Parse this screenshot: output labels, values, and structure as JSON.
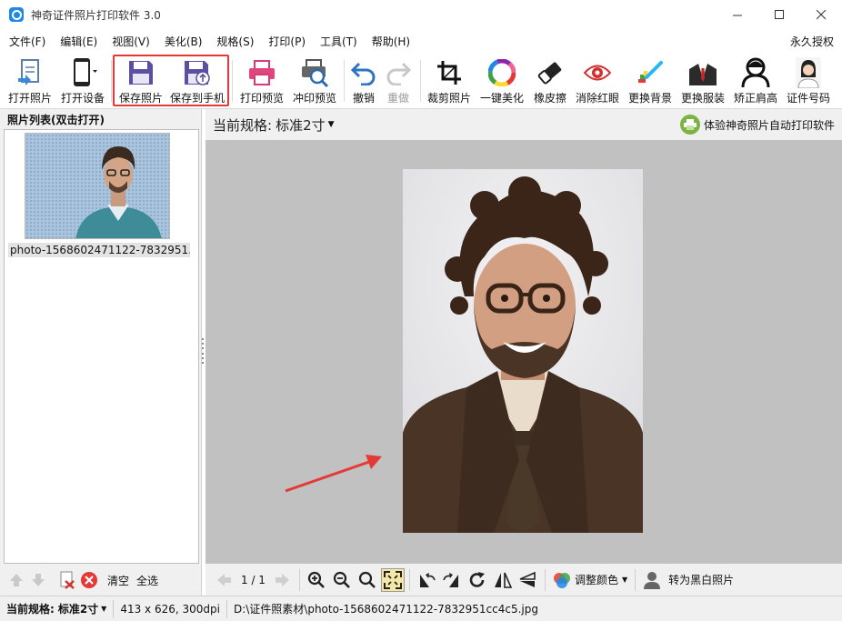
{
  "window": {
    "title": "神奇证件照片打印软件 3.0",
    "controls": [
      "minimize",
      "maximize",
      "close"
    ]
  },
  "menu": {
    "items": [
      "文件(F)",
      "编辑(E)",
      "视图(V)",
      "美化(B)",
      "规格(S)",
      "打印(P)",
      "工具(T)",
      "帮助(H)"
    ],
    "license": "永久授权"
  },
  "toolbar": {
    "items": [
      {
        "label": "打开照片",
        "icon": "open-photo-icon"
      },
      {
        "label": "打开设备",
        "icon": "phone-device-icon"
      },
      {
        "label": "保存照片",
        "icon": "save-icon"
      },
      {
        "label": "保存到手机",
        "icon": "save-to-phone-icon"
      },
      {
        "label": "打印预览",
        "icon": "printer-icon"
      },
      {
        "label": "冲印预览",
        "icon": "print-preview-icon"
      },
      {
        "label": "撤销",
        "icon": "undo-icon"
      },
      {
        "label": "重做",
        "icon": "redo-icon"
      },
      {
        "label": "裁剪照片",
        "icon": "crop-icon"
      },
      {
        "label": "一键美化",
        "icon": "color-wheel-icon"
      },
      {
        "label": "橡皮擦",
        "icon": "eraser-icon"
      },
      {
        "label": "消除红眼",
        "icon": "red-eye-icon"
      },
      {
        "label": "更换背景",
        "icon": "change-background-icon"
      },
      {
        "label": "更换服装",
        "icon": "suit-icon"
      },
      {
        "label": "矫正肩高",
        "icon": "shoulder-icon"
      },
      {
        "label": "证件号码",
        "icon": "id-photo-icon"
      }
    ]
  },
  "left_panel": {
    "title": "照片列表(双击打开)",
    "photo_name": "photo-1568602471122-7832951...",
    "clear_label": "清空",
    "select_all_label": "全选"
  },
  "main": {
    "spec_label": "当前规格:",
    "spec_value": "标准2寸",
    "promo": "体验神奇照片自动打印软件",
    "page_indicator": "1 / 1",
    "adjust_color_label": "调整颜色",
    "to_bw_label": "转为黑白照片"
  },
  "status": {
    "spec_label": "当前规格:",
    "spec_value": "标准2寸",
    "dimensions": "413 x 626, 300dpi",
    "file_path": "D:\\证件照素材\\photo-1568602471122-7832951cc4c5.jpg"
  },
  "colors": {
    "highlight_border": "#e53935",
    "arrow": "#e53935",
    "canvas_bg": "#c1c1c1",
    "accent_blue": "#1e88e5"
  }
}
